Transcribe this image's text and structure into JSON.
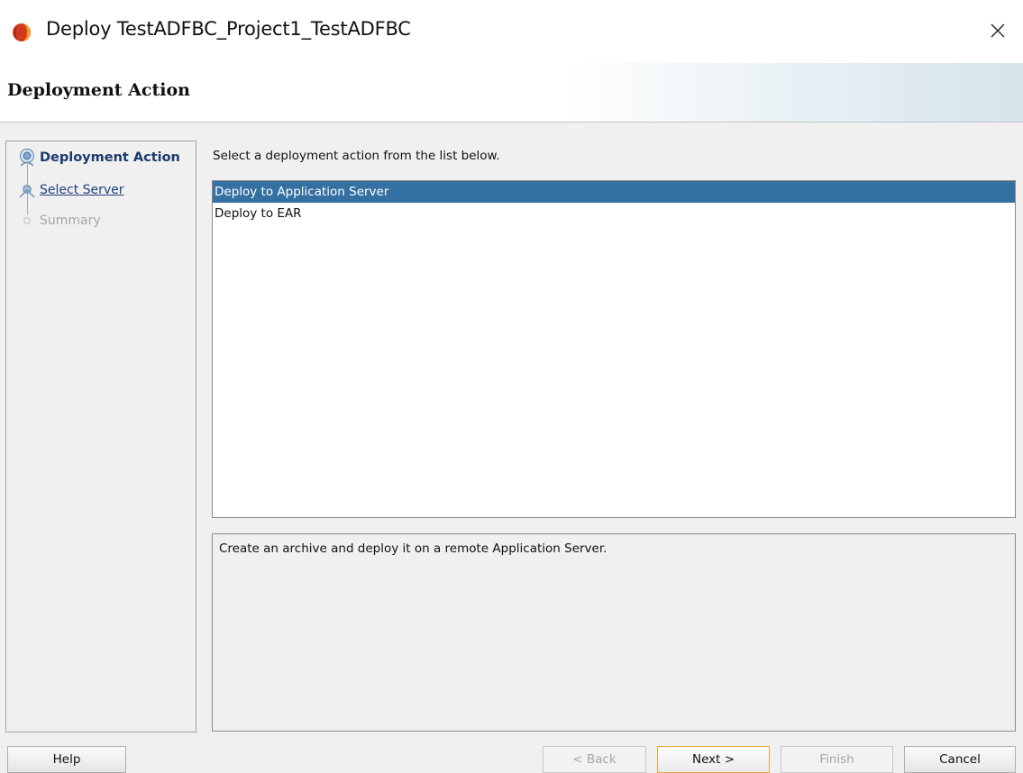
{
  "window": {
    "title": "Deploy TestADFBC_Project1_TestADFBC",
    "close_glyph": "×"
  },
  "header": {
    "title": "Deployment Action"
  },
  "nav": {
    "items": [
      {
        "label": "Deployment Action",
        "state": "current",
        "icon": "current-step-icon"
      },
      {
        "label": "Select Server",
        "state": "link",
        "icon": "next-step-icon"
      },
      {
        "label": "Summary",
        "state": "disabled",
        "icon": "pending-step-icon"
      }
    ]
  },
  "main": {
    "instruction": "Select a deployment action from the list below.",
    "actions": [
      {
        "label": "Deploy to Application Server",
        "selected": true
      },
      {
        "label": "Deploy to EAR",
        "selected": false
      }
    ],
    "description": "Create an archive and deploy it on a remote Application Server."
  },
  "buttons": {
    "help": "Help",
    "back": "< Back",
    "next": "Next >",
    "finish": "Finish",
    "cancel": "Cancel"
  },
  "colors": {
    "selection": "#3470a1",
    "nav_current": "#1d3a6e",
    "default_button_border": "#e6a83b"
  }
}
